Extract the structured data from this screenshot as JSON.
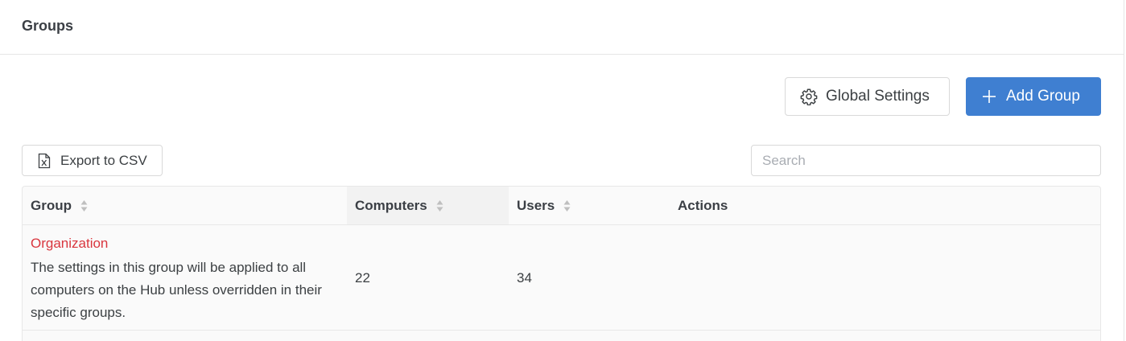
{
  "header": {
    "title": "Groups"
  },
  "toolbar": {
    "global_settings_label": "Global Settings",
    "add_group_label": "Add Group",
    "export_label": "Export to CSV",
    "search_placeholder": "Search"
  },
  "table": {
    "columns": [
      "Group",
      "Computers",
      "Users",
      "Actions"
    ],
    "rows": [
      {
        "name": "Organization",
        "description": "The settings in this group will be applied to all computers on the Hub unless overridden in their specific groups.",
        "computers": "22",
        "users": "34",
        "actions": ""
      }
    ]
  },
  "colors": {
    "primary": "#3f7fd1",
    "group_link": "#d9363e",
    "border": "#e6e6e6"
  },
  "icons": {
    "global_settings": "gear-icon",
    "add_group": "plus-icon",
    "export": "excel-file-icon",
    "sort": "sort-icon"
  }
}
